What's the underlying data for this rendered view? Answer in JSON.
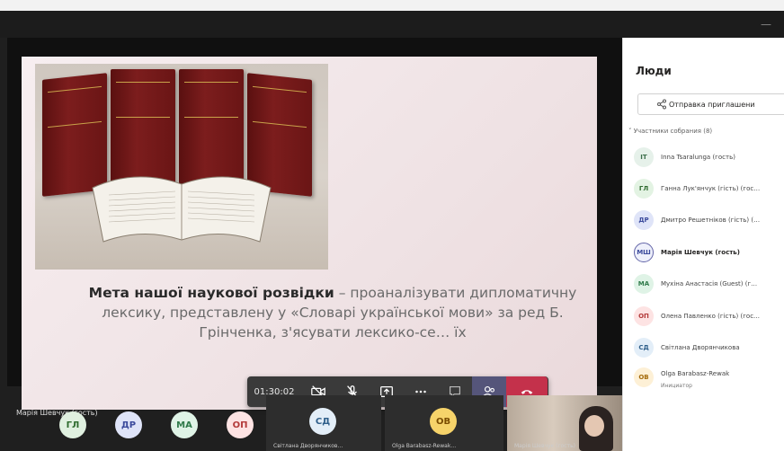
{
  "window": {
    "minimize_glyph": "—"
  },
  "slide": {
    "text_bold": "Мета нашої наукової розвідки",
    "text_rest": " – проаналізувати дипломатичну лексику, представлену у «Словарі української мови» за ред Б. Грінченка, з'ясувати лексико-се… їх"
  },
  "stage": {
    "speaker_name": "Марія Шевчук (гость)"
  },
  "controls": {
    "timer": "01:30:02"
  },
  "gallery": {
    "tiles": [
      {
        "initials": "ГЛ",
        "color": "#e0f0e0",
        "fg": "#2e6b2e"
      },
      {
        "initials": "ДР",
        "color": "#dfe4f8",
        "fg": "#3b4a9c"
      },
      {
        "initials": "МА",
        "color": "#dff3e6",
        "fg": "#2f7a4a"
      },
      {
        "initials": "ОП",
        "color": "#fde3e3",
        "fg": "#b33a3a"
      }
    ],
    "sd": {
      "initials": "СД",
      "name": "Світлана Дворянчиков…"
    },
    "ob": {
      "initials": "ОВ",
      "name": "Olga Barabasz-Rewak…"
    },
    "video_name": "Марія Шевчук (гость)"
  },
  "people": {
    "title": "Люди",
    "share_label": "Отправка приглашени",
    "section": "Участники собрания (8)",
    "members": [
      {
        "initials": "IT",
        "name": "Inna Tsaralunga (гость)",
        "bg": "#e6f1ea",
        "fg": "#3b6e4a"
      },
      {
        "initials": "ГЛ",
        "name": "Ганна Лук'янчук (гість) (гос…",
        "bg": "#e3f3e3",
        "fg": "#2f6b2f"
      },
      {
        "initials": "ДР",
        "name": "Дмитро Решетніков (гість) (…",
        "bg": "#dfe4f8",
        "fg": "#3b4a9c"
      },
      {
        "initials": "МШ",
        "name": "Марія Шевчук (гость)",
        "bg": "#eef0fb",
        "fg": "#3b4a9c",
        "bold": true
      },
      {
        "initials": "МА",
        "name": "Мухіна Анастасія (Guest) (г…",
        "bg": "#dff3e6",
        "fg": "#2f7a4a"
      },
      {
        "initials": "ОП",
        "name": "Олена Павленко (гість) (гос…",
        "bg": "#fde3e3",
        "fg": "#b33a3a"
      },
      {
        "initials": "СД",
        "name": "Світлана Дворянчикова",
        "bg": "#e3eef8",
        "fg": "#2f5f8a"
      },
      {
        "initials": "ОВ",
        "name": "Olga Barabasz-Rewak",
        "bg": "#fdf0d6",
        "fg": "#a46a0a",
        "sub": "Инициатор"
      }
    ]
  }
}
